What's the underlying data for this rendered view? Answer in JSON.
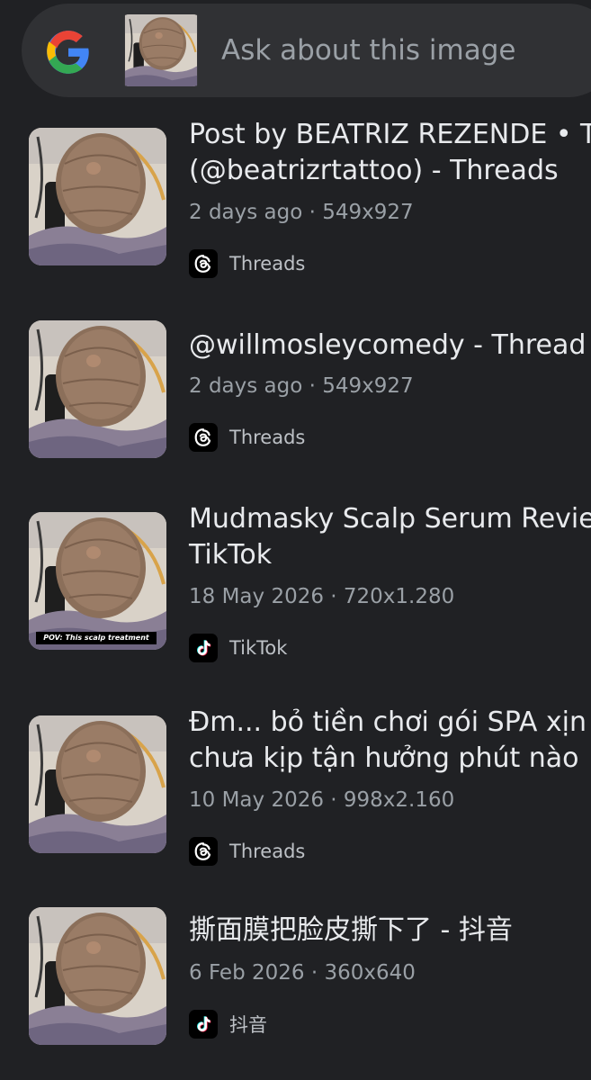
{
  "search": {
    "placeholder": "Ask about this image"
  },
  "results": [
    {
      "title_lines": [
        "Post by BEATRIZ REZENDE • T",
        "(@beatrizrtattoo) - Threads"
      ],
      "meta": "2 days ago · 549x927",
      "source": "Threads",
      "source_icon": "threads-icon"
    },
    {
      "title_lines": [
        "@willmosleycomedy - Thread"
      ],
      "meta": "2 days ago · 549x927",
      "source": "Threads",
      "source_icon": "threads-icon"
    },
    {
      "title_lines": [
        "Mudmasky Scalp Serum Revie",
        "TikTok"
      ],
      "meta": "18 May 2026 · 720x1.280",
      "source": "TikTok",
      "source_icon": "tiktok-icon",
      "thumb_caption": "POV: This scalp treatment"
    },
    {
      "title_lines": [
        "Đm... bỏ tiền chơi gói SPA xịn",
        "chưa kịp tận hưởng phút nào"
      ],
      "meta": "10 May 2026 · 998x2.160",
      "source": "Threads",
      "source_icon": "threads-icon"
    },
    {
      "title_lines": [
        "撕面膜把脸皮撕下了 - 抖音"
      ],
      "meta": "6 Feb 2026 · 360x640",
      "source": "抖音",
      "source_icon": "tiktok-icon"
    }
  ],
  "colors": {
    "background": "#202124",
    "search_bar": "#303134",
    "title_text": "#e8eaed",
    "meta_text": "#9aa0a6"
  }
}
